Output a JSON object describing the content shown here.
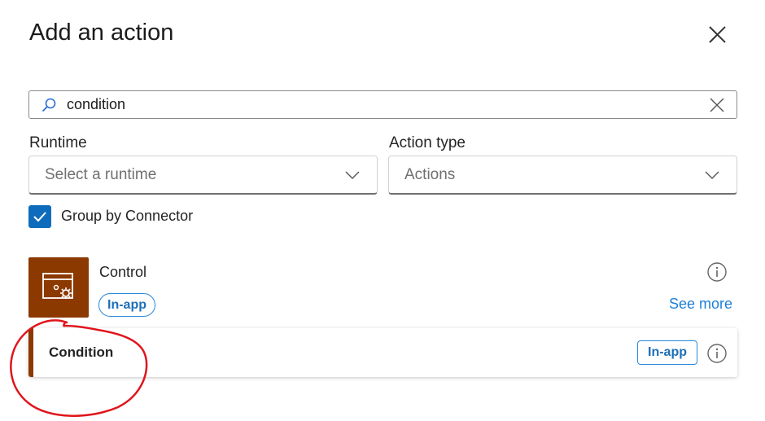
{
  "dialog": {
    "title": "Add an action",
    "close_icon": "close-icon"
  },
  "search": {
    "value": "condition",
    "icon": "search-icon",
    "clear_icon": "clear-icon"
  },
  "filters": {
    "runtime": {
      "label": "Runtime",
      "placeholder": "Select a runtime"
    },
    "action_type": {
      "label": "Action type",
      "value": "Actions"
    }
  },
  "group_by_connector": {
    "label": "Group by Connector",
    "checked": true
  },
  "connector": {
    "name": "Control",
    "badge": "In-app",
    "see_more": "See more",
    "color": "#8c3900"
  },
  "actions": [
    {
      "name": "Condition",
      "badge": "In-app"
    }
  ],
  "colors": {
    "accent_blue": "#0f6cbd",
    "link_blue": "#1e7fd6",
    "annotation_red": "#e0151b"
  }
}
